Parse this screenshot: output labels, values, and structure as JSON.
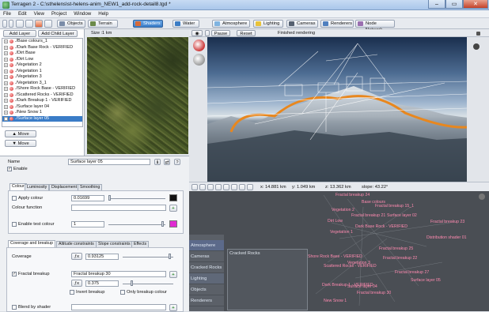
{
  "window": {
    "title": "Terragen 2 - C:\\sthelens\\st-helens-anim_NEW1_add-rock-detail8.tgd *",
    "minimize": "–",
    "maximize": "▭",
    "close": "✕"
  },
  "menu": [
    "File",
    "Edit",
    "View",
    "Project",
    "Window",
    "Help"
  ],
  "toolbar": {
    "items": [
      {
        "label": "Objects",
        "color": "#7a8ca8"
      },
      {
        "label": "Terrain",
        "color": "#6b8a4a"
      },
      {
        "label": "Shaders",
        "color": "#d46a3a"
      },
      {
        "label": "Water",
        "color": "#3b7cc4"
      },
      {
        "label": "Atmosphere",
        "color": "#7fb3e0"
      },
      {
        "label": "Lighting",
        "color": "#e8c23a"
      },
      {
        "label": "Cameras",
        "color": "#556070"
      },
      {
        "label": "Renderers",
        "color": "#4f7fbf"
      },
      {
        "label": "Node Network",
        "color": "#9a6fb0"
      }
    ]
  },
  "layers": {
    "add_layer": "Add Layer",
    "add_child_layer": "Add Child Layer",
    "items": [
      "./Base colours_1",
      "./Dark Base Rock - VERIFIED",
      "./Dirt Base",
      "./Dirt Low",
      "./Vegetation 2",
      "./Vegetation 1",
      "./Vegetation 3",
      "./Vegetation 3_1",
      "./Shore Rock Base - VERIFIED",
      "./Scattered Rocks - VERIFIED",
      "./Dark Breakup 1 - VERIFIED",
      "./Surface layer 04",
      "./New Snow 1",
      "./Surface layer 05"
    ],
    "move_up": "Move",
    "move_down": "Move"
  },
  "preview": {
    "size_label": "Size :",
    "size_value": "1 km"
  },
  "properties": {
    "name_label": "Name",
    "name_value": "Surface layer 05",
    "enable_label": "Enable",
    "tabs": [
      "Colour",
      "Luminosity",
      "Displacement",
      "Smoothing"
    ],
    "apply_colour_label": "Apply colour",
    "apply_colour_value": "0.01699",
    "colour_function_label": "Colour function",
    "enable_test_colour_label": "Enable test colour",
    "test_colour_value": "1",
    "tabs2": [
      "Coverage and breakup",
      "Altitude constraints",
      "Slope constraints",
      "Effects"
    ],
    "coverage_label": "Coverage",
    "coverage_value": "0.93125",
    "fractal_breakup_label": "Fractal breakup",
    "fractal_breakup_shader": "Fractal breakup 30",
    "fractal_breakup_value": "0.375",
    "invert_breakup": "Invert breakup",
    "only_breakup_colour": "Only breakup colour",
    "blend_by_shader": "Blend by shader"
  },
  "viewport": {
    "pause": "Pause",
    "reset": "Reset",
    "status": "Finished rendering",
    "x": "x: 14.881 km",
    "y": "y: 1.049 km",
    "z": "z: 13.362 km",
    "slope": "slope: 43.22°"
  },
  "network": {
    "categories": [
      "Atmosphere",
      "Cameras",
      "Cracked Rocks",
      "Lighting",
      "Objects",
      "Renderers"
    ],
    "group_label": "Cracked Rocks",
    "nodes": [
      "Fractal breakup 24",
      "Base colours",
      "Fractal breakup 15_1",
      "Vegetation 2",
      "Fractal breakup 21",
      "Surface layer 02",
      "Dirt Low",
      "Dark Base Rock - VERIFIED",
      "Shore Rock Base - VERIFIED",
      "Fractal breakup 22",
      "Vegetation 1",
      "Fractal breakup 23",
      "Distribution shader 01",
      "Fractal breakup 25",
      "Vegetation 3",
      "Scattered Rocks - VERIFIED",
      "Dark Breakup 1 - VERIFIED",
      "Surface layer 04",
      "New Snow 1",
      "Fractal breakup 30",
      "Surface layer 05",
      "Fractal breakup 27"
    ]
  }
}
